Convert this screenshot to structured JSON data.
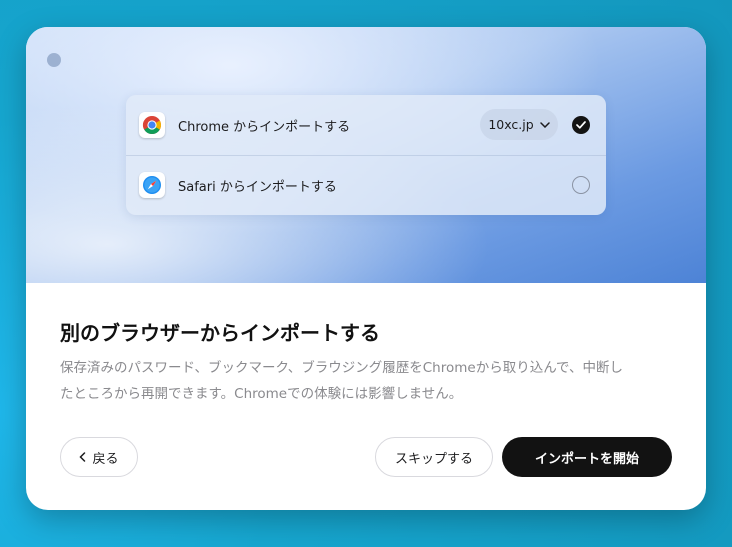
{
  "hero": {
    "rows": [
      {
        "label": "Chrome からインポートする",
        "icon": "chrome-icon",
        "selector_value": "10xc.jp",
        "checked": true
      },
      {
        "label": "Safari からインポートする",
        "icon": "safari-icon",
        "checked": false
      }
    ]
  },
  "content": {
    "title": "別のブラウザーからインポートする",
    "description_line1": "保存済みのパスワード、ブックマーク、ブラウジング履歴をChromeから取り込んで、中断し",
    "description_line2": "たところから再開できます。Chromeでの体験には影響しません。"
  },
  "buttons": {
    "back": "戻る",
    "skip": "スキップする",
    "start": "インポートを開始"
  },
  "colors": {
    "primary_button": "#121212",
    "hero_blue": "#4d83d6",
    "background": "#16a6cf"
  }
}
